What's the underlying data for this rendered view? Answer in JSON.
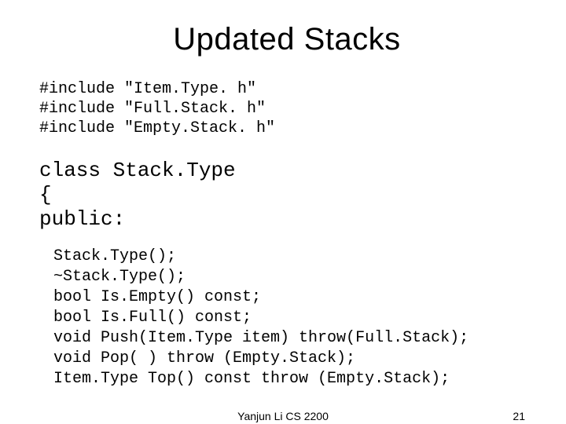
{
  "title": "Updated Stacks",
  "includes": "#include \"Item.Type. h\"\n#include \"Full.Stack. h\"\n#include \"Empty.Stack. h\"",
  "classdecl": "class Stack.Type\n{\npublic:",
  "members": "Stack.Type();\n~Stack.Type();\nbool Is.Empty() const;\nbool Is.Full() const;\nvoid Push(Item.Type item) throw(Full.Stack);\nvoid Pop( ) throw (Empty.Stack);\nItem.Type Top() const throw (Empty.Stack);",
  "footer": {
    "center": "Yanjun Li CS 2200",
    "page": "21"
  }
}
